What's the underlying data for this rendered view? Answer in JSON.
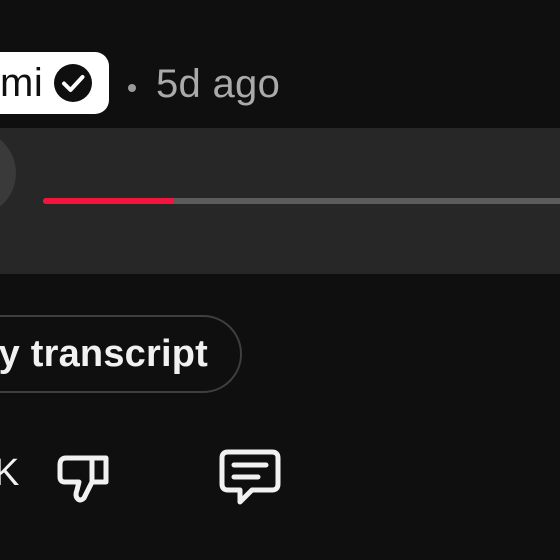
{
  "post": {
    "author_name": "mi",
    "verified": true,
    "time_ago": "5d ago"
  },
  "player": {
    "progress": 0.24,
    "progress_color": "#f2143c"
  },
  "transcript_button": {
    "label": "y transcript"
  },
  "actions": {
    "like_count": "K",
    "dislike_icon": "thumbs-down-icon",
    "comment_icon": "comment-icon"
  }
}
